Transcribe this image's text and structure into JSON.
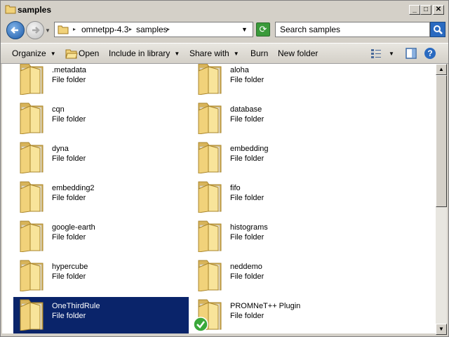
{
  "window": {
    "title": "samples",
    "minimize": "_",
    "maximize": "□",
    "close": "✕"
  },
  "address": {
    "crumbs": [
      "omnetpp-4.3",
      "samples"
    ],
    "search_placeholder": "Search samples"
  },
  "toolbar": {
    "organize": "Organize",
    "open": "Open",
    "include_in_library": "Include in library",
    "share_with": "Share with",
    "burn": "Burn",
    "new_folder": "New folder"
  },
  "items": [
    {
      "name": ".metadata",
      "type": "File folder"
    },
    {
      "name": "aloha",
      "type": "File folder"
    },
    {
      "name": "cqn",
      "type": "File folder"
    },
    {
      "name": "database",
      "type": "File folder"
    },
    {
      "name": "dyna",
      "type": "File folder"
    },
    {
      "name": "embedding",
      "type": "File folder"
    },
    {
      "name": "embedding2",
      "type": "File folder"
    },
    {
      "name": "fifo",
      "type": "File folder"
    },
    {
      "name": "google-earth",
      "type": "File folder"
    },
    {
      "name": "histograms",
      "type": "File folder"
    },
    {
      "name": "hypercube",
      "type": "File folder"
    },
    {
      "name": "neddemo",
      "type": "File folder"
    },
    {
      "name": "OneThirdRule",
      "type": "File folder",
      "selected": true
    },
    {
      "name": "PROMNeT++ Plugin",
      "type": "File folder",
      "badge": "check-icon"
    }
  ],
  "colors": {
    "selection": "#0a246a",
    "folder": "#f1d27a"
  }
}
